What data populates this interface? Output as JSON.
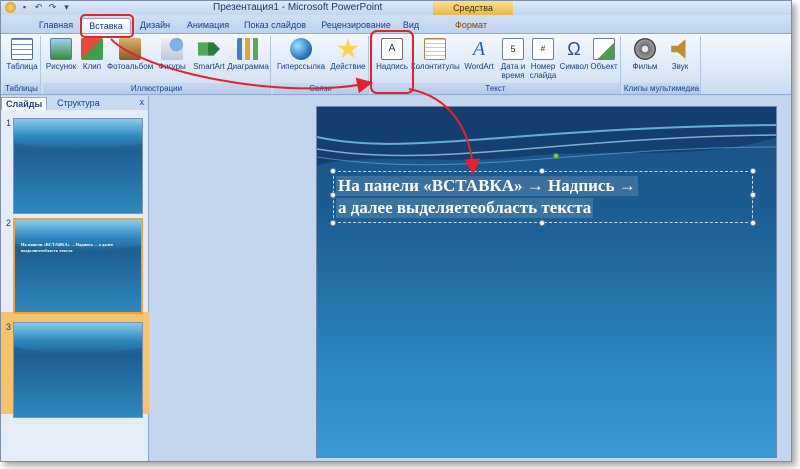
{
  "window": {
    "title": "Презентация1 - Microsoft PowerPoint",
    "context_group": "Средства рисования"
  },
  "tabs": [
    {
      "label": "Главная"
    },
    {
      "label": "Вставка"
    },
    {
      "label": "Дизайн"
    },
    {
      "label": "Анимация"
    },
    {
      "label": "Показ слайдов"
    },
    {
      "label": "Рецензирование"
    },
    {
      "label": "Вид"
    },
    {
      "label": "Формат"
    }
  ],
  "ribbon": {
    "groups": {
      "tables": "Таблицы",
      "illustrations": "Иллюстрации",
      "links": "Связи",
      "text": "Текст",
      "media": "Клипы мультимедиа"
    },
    "buttons": {
      "table": "Таблица",
      "picture": "Рисунок",
      "clip": "Клип",
      "photo_album": "Фотоальбом",
      "shapes": "Фигуры",
      "smartart": "SmartArt",
      "chart": "Диаграмма",
      "hyperlink": "Гиперссылка",
      "action": "Действие",
      "textbox": "Надпись",
      "header_footer": "Колонтитулы",
      "wordart": "WordArt",
      "date_time_1": "Дата и",
      "date_time_2": "время",
      "slide_number_1": "Номер",
      "slide_number_2": "слайда",
      "symbol": "Символ",
      "object": "Объект",
      "movie": "Фильм",
      "sound": "Звук"
    }
  },
  "panel": {
    "tabs": [
      "Слайды",
      "Структура"
    ],
    "close": "x",
    "thumbs": [
      {
        "num": "1",
        "text": ""
      },
      {
        "num": "2",
        "text": "На панели «ВСТАВКА» →Надпись→ а далее выделяетеобласть текста"
      },
      {
        "num": "3",
        "text": ""
      }
    ]
  },
  "slide": {
    "line1": "На панели «ВСТАВКА» → Надпись →",
    "line2": "а далее  выделяетеобласть  текста"
  },
  "colors": {
    "annotation": "#e8202a",
    "slide_top": "#1c4f82",
    "slide_bottom": "#3a9bd2"
  }
}
